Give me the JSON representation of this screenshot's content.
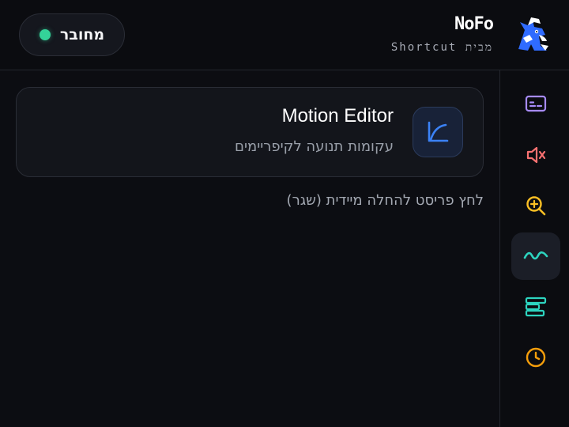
{
  "header": {
    "connection_label": "מחובר",
    "connection_color": "#34d399",
    "brand_name": "NoFo",
    "brand_sub": "מבית Shortcut",
    "mascot_icon": "mascot-icon"
  },
  "sidebar": {
    "items": [
      {
        "icon": "subtitles-icon",
        "color": "#a78bfa",
        "active": false
      },
      {
        "icon": "mute-icon",
        "color": "#f87171",
        "active": false
      },
      {
        "icon": "zoom-in-icon",
        "color": "#fbbf24",
        "active": false
      },
      {
        "icon": "wave-icon",
        "color": "#2dd4bf",
        "active": true
      },
      {
        "icon": "timeline-icon",
        "color": "#2dd4bf",
        "active": false
      },
      {
        "icon": "clock-icon",
        "color": "#f59e0b",
        "active": false
      }
    ]
  },
  "main": {
    "card": {
      "title": "Motion Editor",
      "subtitle": "עקומות תנועה לקיפריימים",
      "icon": "curve-icon",
      "accent": "#3b82f6"
    },
    "hint": "לחץ פריסט להחלה מיידית (שגר)"
  }
}
